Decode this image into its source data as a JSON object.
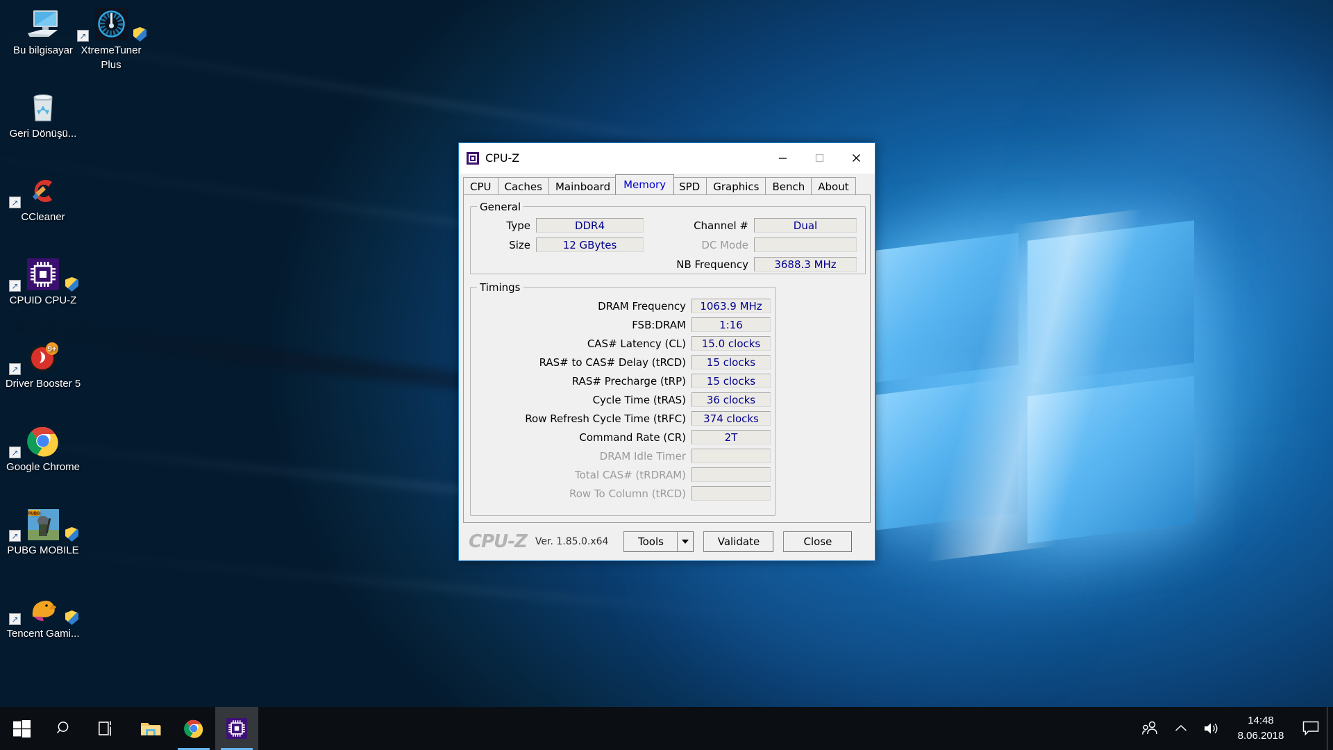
{
  "desktop": {
    "icons": [
      {
        "name": "Bu bilgisayar",
        "icon": "this-pc-icon",
        "shortcut": false,
        "shield": false
      },
      {
        "name": "XtremeTuner Plus",
        "icon": "xtremetuner-icon",
        "shortcut": true,
        "shield": true
      },
      {
        "name": "Geri Dönüşü...",
        "icon": "recycle-bin-icon",
        "shortcut": false,
        "shield": false
      },
      {
        "name": "CCleaner",
        "icon": "ccleaner-icon",
        "shortcut": true,
        "shield": false
      },
      {
        "name": "CPUID CPU-Z",
        "icon": "cpuz-icon",
        "shortcut": true,
        "shield": true
      },
      {
        "name": "Driver Booster 5",
        "icon": "driver-booster-icon",
        "shortcut": true,
        "shield": false
      },
      {
        "name": "Google Chrome",
        "icon": "chrome-icon",
        "shortcut": true,
        "shield": false
      },
      {
        "name": "PUBG MOBILE",
        "icon": "pubg-mobile-icon",
        "shortcut": true,
        "shield": true
      },
      {
        "name": "Tencent Gami...",
        "icon": "tencent-gaming-icon",
        "shortcut": true,
        "shield": true
      }
    ]
  },
  "taskbar": {
    "start_label": "Start",
    "search_label": "Search",
    "taskview_label": "Task View",
    "explorer_label": "File Explorer",
    "chrome_label": "Google Chrome",
    "cpuz_label": "CPU-Z",
    "tray": {
      "people_label": "People",
      "show_hidden_label": "Show hidden icons",
      "volume_label": "Speakers",
      "action_center_label": "Action Center"
    },
    "clock": {
      "time": "14:48",
      "date": "8.06.2018"
    }
  },
  "cpuz": {
    "window_title": "CPU-Z",
    "titlebar_buttons": {
      "minimize": "—",
      "maximize": "□",
      "close": "✕"
    },
    "tabs": [
      {
        "label": "CPU",
        "active": false
      },
      {
        "label": "Caches",
        "active": false
      },
      {
        "label": "Mainboard",
        "active": false
      },
      {
        "label": "Memory",
        "active": true
      },
      {
        "label": "SPD",
        "active": false
      },
      {
        "label": "Graphics",
        "active": false
      },
      {
        "label": "Bench",
        "active": false
      },
      {
        "label": "About",
        "active": false
      }
    ],
    "general": {
      "legend": "General",
      "left": [
        {
          "label": "Type",
          "value": "DDR4",
          "disabled": false
        },
        {
          "label": "Size",
          "value": "12 GBytes",
          "disabled": false
        }
      ],
      "right": [
        {
          "label": "Channel #",
          "value": "Dual",
          "disabled": false
        },
        {
          "label": "DC Mode",
          "value": "",
          "disabled": true
        },
        {
          "label": "NB Frequency",
          "value": "3688.3 MHz",
          "disabled": false
        }
      ]
    },
    "timings": {
      "legend": "Timings",
      "rows": [
        {
          "label": "DRAM Frequency",
          "value": "1063.9 MHz",
          "disabled": false
        },
        {
          "label": "FSB:DRAM",
          "value": "1:16",
          "disabled": false
        },
        {
          "label": "CAS# Latency (CL)",
          "value": "15.0 clocks",
          "disabled": false
        },
        {
          "label": "RAS# to CAS# Delay (tRCD)",
          "value": "15 clocks",
          "disabled": false
        },
        {
          "label": "RAS# Precharge (tRP)",
          "value": "15 clocks",
          "disabled": false
        },
        {
          "label": "Cycle Time (tRAS)",
          "value": "36 clocks",
          "disabled": false
        },
        {
          "label": "Row Refresh Cycle Time (tRFC)",
          "value": "374 clocks",
          "disabled": false
        },
        {
          "label": "Command Rate (CR)",
          "value": "2T",
          "disabled": false
        },
        {
          "label": "DRAM Idle Timer",
          "value": "",
          "disabled": true
        },
        {
          "label": "Total CAS# (tRDRAM)",
          "value": "",
          "disabled": true
        },
        {
          "label": "Row To Column (tRCD)",
          "value": "",
          "disabled": true
        }
      ]
    },
    "footer": {
      "logo": "CPU-Z",
      "version": "Ver. 1.85.0.x64",
      "tools_label": "Tools",
      "validate_label": "Validate",
      "close_label": "Close"
    }
  },
  "colors": {
    "value_text": "#00008f",
    "active_tab_text": "#0000d0",
    "disabled_text": "#9b9b9b",
    "window_border": "#1e7bc4",
    "taskbar": "#0b0f14"
  }
}
